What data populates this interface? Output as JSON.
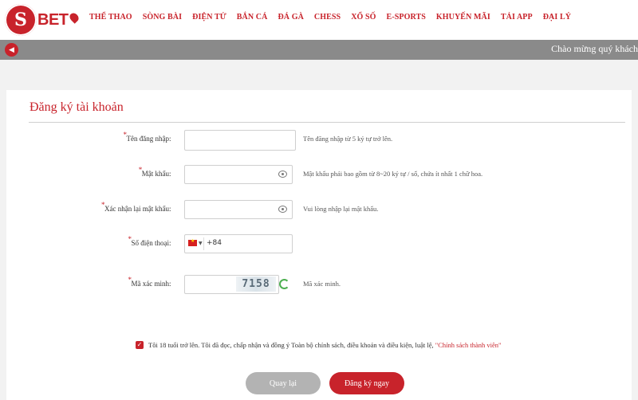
{
  "brand": {
    "logo_mark": "S",
    "logo_text": "BET",
    "accent_color": "#c8232b"
  },
  "nav": {
    "items": [
      "THỂ THAO",
      "SÒNG BÀI",
      "ĐIỆN TỬ",
      "BẮN CÁ",
      "ĐÁ GÀ",
      "CHESS",
      "XỔ SỐ",
      "E-SPORTS",
      "KHUYẾN MÃI",
      "TẢI APP",
      "ĐẠI LÝ"
    ]
  },
  "marquee": {
    "icon": "speaker-icon",
    "text": "Chào mừng quý khách"
  },
  "form": {
    "title": "Đăng ký tài khoản",
    "fields": [
      {
        "label": "Tên đăng nhập",
        "hint": "Tên đăng nhập từ 5 ký tự trở lên."
      },
      {
        "label": "Mật khẩu",
        "hint": "Mật khẩu phải bao gồm từ 8~20 ký tự / số, chứa ít nhất 1 chữ hoa."
      },
      {
        "label": "Xác nhận lại mật khẩu",
        "hint": "Vui lòng nhập lại mật khẩu."
      },
      {
        "label": "Số điện thoại",
        "phone_code": "+84"
      },
      {
        "label": "Mã xác minh",
        "captcha": "7158",
        "hint": "Mã xác minh."
      }
    ],
    "agree_text": "Tôi 18 tuổi trở lên. Tôi đã đọc, chấp nhận và đồng ý Toàn bộ chính sách, điều khoản và điều kiện,  luật lệ,",
    "agree_link": "\"Chính sách thành viên\"",
    "back_label": "Quay lại",
    "register_label": "Đăng ký ngay"
  }
}
